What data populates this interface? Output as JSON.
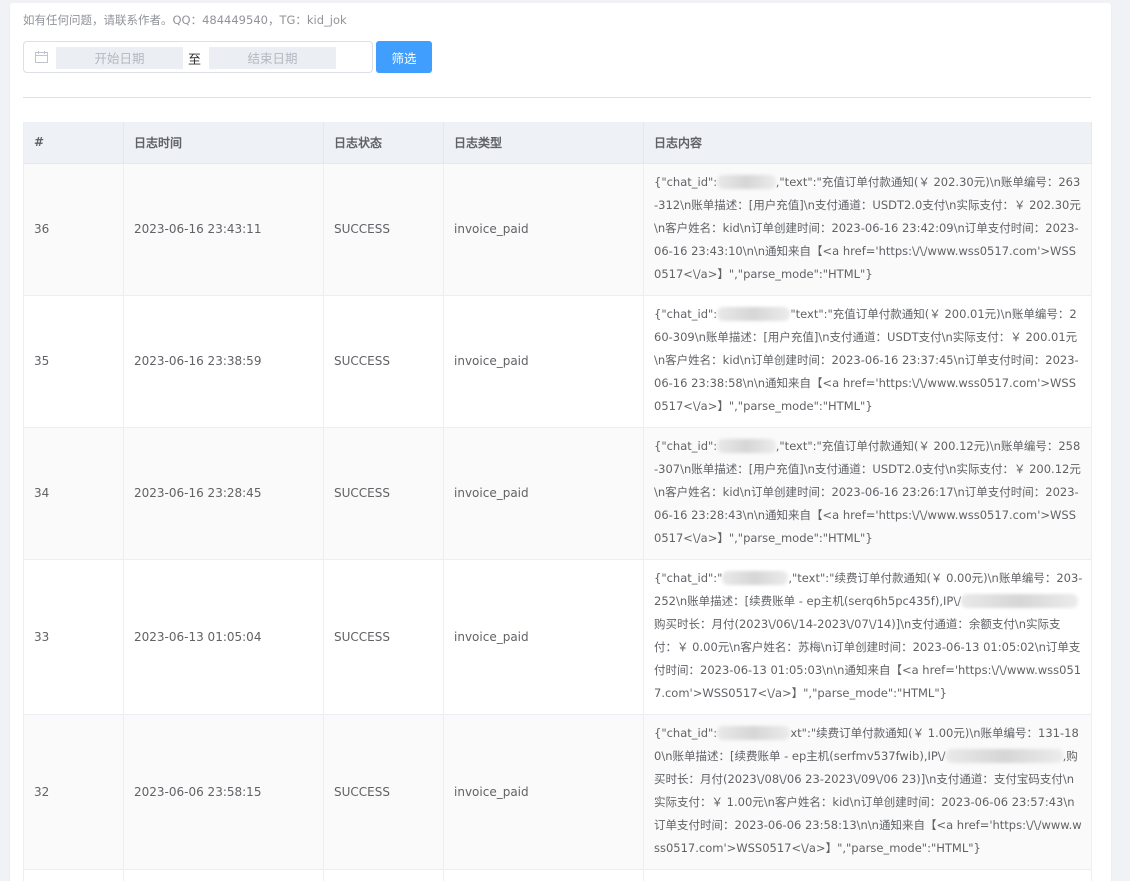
{
  "notice": "如有任何问题，请联系作者。QQ：484449540，TG：kid_jok",
  "filter": {
    "start_placeholder": "开始日期",
    "separator": "至",
    "end_placeholder": "结束日期",
    "button_label": "筛选"
  },
  "table": {
    "headers": [
      "#",
      "日志时间",
      "日志状态",
      "日志类型",
      "日志内容"
    ],
    "rows": [
      {
        "id": "36",
        "time": "2023-06-16 23:43:11",
        "status": "SUCCESS",
        "type": "invoice_paid",
        "content_pre": "{\"chat_id\":",
        "content_post": ",\"text\":\"充值订单付款通知(￥ 202.30元)\\n账单编号：263-312\\n账单描述：[用户充值]\\n支付通道：USDT2.0支付\\n实际支付：￥ 202.30元\\n客户姓名：kid\\n订单创建时间：2023-06-16 23:42:09\\n订单支付时间：2023-06-16 23:43:10\\n\\n通知来自【<a href='https:\\/\\/www.wss0517.com'>WSS0517<\\/a>】\",\"parse_mode\":\"HTML\"}"
      },
      {
        "id": "35",
        "time": "2023-06-16 23:38:59",
        "status": "SUCCESS",
        "type": "invoice_paid",
        "content_pre": "{\"chat_id\":",
        "content_post": "\"text\":\"充值订单付款通知(￥ 200.01元)\\n账单编号：260-309\\n账单描述：[用户充值]\\n支付通道：USDT支付\\n实际支付：￥ 200.01元\\n客户姓名：kid\\n订单创建时间：2023-06-16 23:37:45\\n订单支付时间：2023-06-16 23:38:58\\n\\n通知来自【<a href='https:\\/\\/www.wss0517.com'>WSS0517<\\/a>】\",\"parse_mode\":\"HTML\"}"
      },
      {
        "id": "34",
        "time": "2023-06-16 23:28:45",
        "status": "SUCCESS",
        "type": "invoice_paid",
        "content_pre": "{\"chat_id\":",
        "content_post": ",\"text\":\"充值订单付款通知(￥ 200.12元)\\n账单编号：258-307\\n账单描述：[用户充值]\\n支付通道：USDT2.0支付\\n实际支付：￥ 200.12元\\n客户姓名：kid\\n订单创建时间：2023-06-16 23:26:17\\n订单支付时间：2023-06-16 23:28:43\\n\\n通知来自【<a href='https:\\/\\/www.wss0517.com'>WSS0517<\\/a>】\",\"parse_mode\":\"HTML\"}"
      },
      {
        "id": "33",
        "time": "2023-06-13 01:05:04",
        "status": "SUCCESS",
        "type": "invoice_paid",
        "content_pre": "{\"chat_id\":\"",
        "content_post": ",\"text\":\"续费订单付款通知(￥ 0.00元)\\n账单编号：203-252\\n账单描述：[续费账单 - ep主机(serq6h5pc435f),IP\\/",
        "content_tail": "购买时长：月付(2023\\/06\\/14-2023\\/07\\/14)]\\n支付通道：余额支付\\n实际支付：￥ 0.00元\\n客户姓名：苏梅\\n订单创建时间：2023-06-13 01:05:02\\n订单支付时间：2023-06-13 01:05:03\\n\\n通知来自【<a href='https:\\/\\/www.wss0517.com'>WSS0517<\\/a>】\",\"parse_mode\":\"HTML\"}"
      },
      {
        "id": "32",
        "time": "2023-06-06 23:58:15",
        "status": "SUCCESS",
        "type": "invoice_paid",
        "content_pre": "{\"chat_id\":",
        "content_post": "xt\":\"续费订单付款通知(￥ 1.00元)\\n账单编号：131-180\\n账单描述：[续费账单 - ep主机(serfmv537fwib),IP\\/",
        "content_tail": ",购买时长：月付(2023\\/08\\/06 23-2023\\/09\\/06 23)]\\n支付通道：支付宝码支付\\n实际支付：￥ 1.00元\\n客户姓名：kid\\n订单创建时间：2023-06-06 23:57:43\\n订单支付时间：2023-06-06 23:58:13\\n\\n通知来自【<a href='https:\\/\\/www.wss0517.com'>WSS0517<\\/a>】\",\"parse_mode\":\"HTML\"}"
      }
    ]
  }
}
